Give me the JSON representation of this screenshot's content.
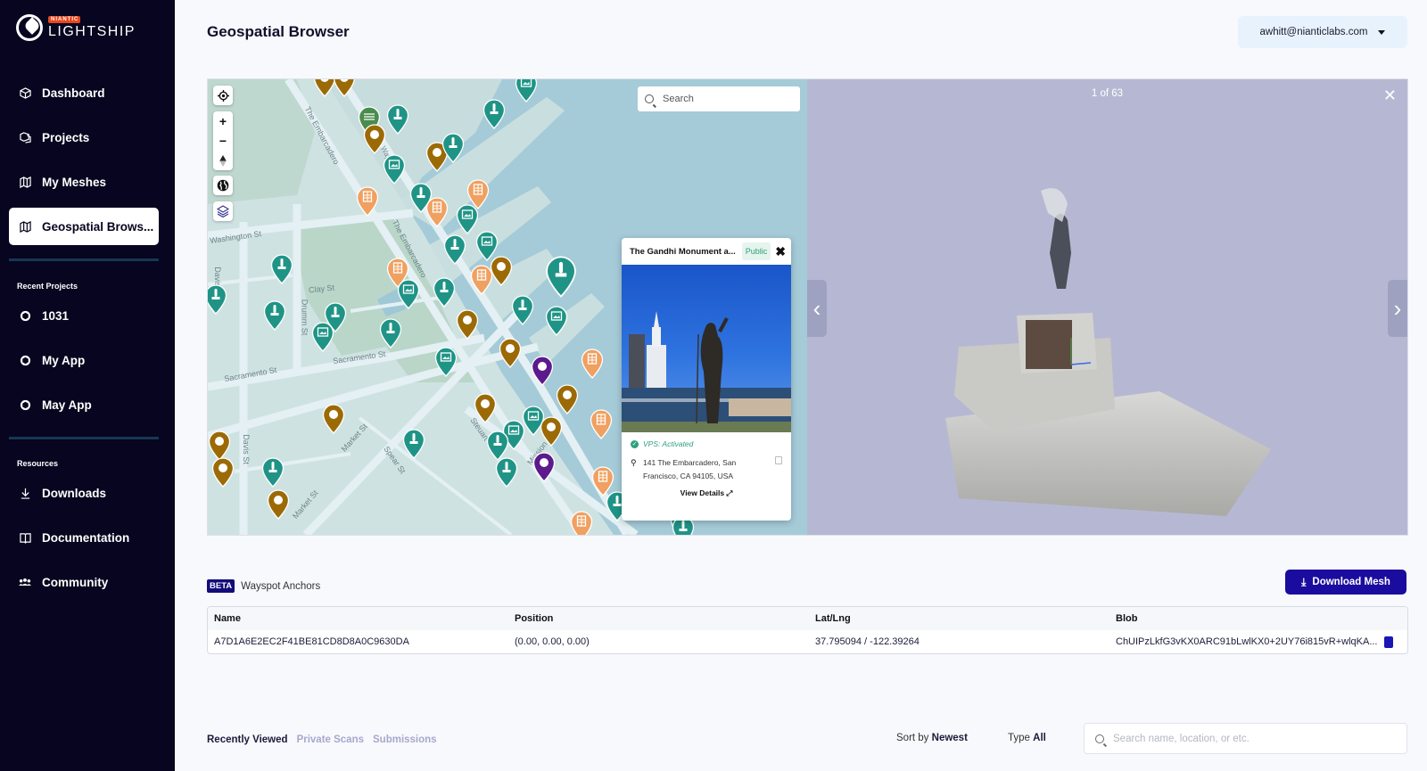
{
  "brand": {
    "badge": "NIANTIC",
    "name": "LIGHTSHIP"
  },
  "sidebar": {
    "main_items": [
      {
        "label": "Dashboard",
        "icon": "cube-icon",
        "active": false
      },
      {
        "label": "Projects",
        "icon": "cubes-icon",
        "active": false
      },
      {
        "label": "My Meshes",
        "icon": "map-icon",
        "active": false
      },
      {
        "label": "Geospatial Brows...",
        "icon": "map-icon",
        "active": true
      }
    ],
    "recent_label": "Recent Projects",
    "recent_items": [
      {
        "label": "1031",
        "icon": "unity-icon"
      },
      {
        "label": "My App",
        "icon": "unity-icon"
      },
      {
        "label": "May App",
        "icon": "unity-icon"
      }
    ],
    "resources_label": "Resources",
    "resource_items": [
      {
        "label": "Downloads",
        "icon": "download-icon"
      },
      {
        "label": "Documentation",
        "icon": "book-icon"
      },
      {
        "label": "Community",
        "icon": "people-icon"
      }
    ]
  },
  "header": {
    "title": "Geospatial Browser",
    "account": "awhitt@nianticlabs.com"
  },
  "map": {
    "search_placeholder": "Search",
    "controls": [
      "locate-icon",
      "zoom-in-icon",
      "zoom-out-icon",
      "compass-icon",
      "globe-icon",
      "layers-icon"
    ],
    "streets": [
      "The Embarcadero",
      "Herb Caen Way",
      "Washington St",
      "Clay St",
      "Drumm St",
      "Davis St",
      "Sacramento St",
      "Sacramento St",
      "The Embarcadero",
      "Market St",
      "Spear St",
      "Steuart St",
      "Mission St",
      "Davis St",
      "Market St"
    ],
    "colors": {
      "monument": "#1f9486",
      "gallery": "#1f9486",
      "generic": "#9c6a05",
      "building": "#f0a060",
      "special": "#5c1a8c",
      "park": "#4a8c4e"
    }
  },
  "popup": {
    "title": "The Gandhi Monument a...",
    "visibility": "Public",
    "vps_status": "VPS: Activated",
    "address_line1": "141 The Embarcadero, San",
    "address_line2": "Francisco, CA 94105, USA",
    "view_details": "View Details"
  },
  "preview": {
    "counter": "1 of 63",
    "prev_label": "‹",
    "next_label": "›",
    "close_label": "✕"
  },
  "anchors": {
    "badge": "BETA",
    "title": "Wayspot Anchors",
    "download_label": "Download Mesh",
    "columns": [
      "Name",
      "Position",
      "Lat/Lng",
      "Blob"
    ],
    "rows": [
      {
        "name": "A7D1A6E2EC2F41BE81CD8D8A0C9630DA",
        "position": "(0.00, 0.00, 0.00)",
        "latlng": "37.795094 / -122.39264",
        "blob": "ChUIPzLkfG3vKX0ARC91bLwlKX0+2UY76i815vR+wlqKA..."
      }
    ]
  },
  "bottom": {
    "tabs": [
      {
        "label": "Recently Viewed",
        "active": true
      },
      {
        "label": "Private Scans",
        "active": false
      },
      {
        "label": "Submissions",
        "active": false
      }
    ],
    "sort_label": "Sort by",
    "sort_value": "Newest",
    "type_label": "Type",
    "type_value": "All",
    "search_placeholder": "Search name, location, or etc."
  }
}
